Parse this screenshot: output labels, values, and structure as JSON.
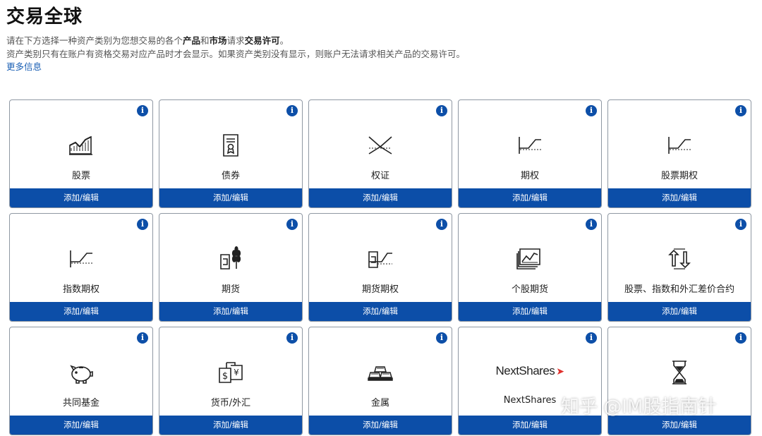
{
  "header": {
    "title": "交易全球",
    "desc_line1_pre": "请在下方选择一种资产类别为您想交易的各个",
    "desc_line1_b1": "产品",
    "desc_line1_and": "和",
    "desc_line1_b2": "市场",
    "desc_line1_mid": "请求",
    "desc_line1_b3": "交易许可",
    "desc_line1_end": "。",
    "desc_line2": "资产类别只有在账户有资格交易对应产品时才会显示。如果资产类别没有显示，则账户无法请求相关产品的交易许可。",
    "more_link": "更多信息"
  },
  "info_glyph": "i",
  "colors": {
    "accent": "#0c4ea8",
    "info": "#0d4fa8",
    "nextshares_red": "#e0312d"
  },
  "cards": [
    {
      "label": "股票",
      "icon": "stock-chart-icon",
      "action": "添加/编辑"
    },
    {
      "label": "债券",
      "icon": "bond-document-icon",
      "action": "添加/编辑"
    },
    {
      "label": "权证",
      "icon": "warrant-cross-icon",
      "action": "添加/编辑"
    },
    {
      "label": "期权",
      "icon": "option-payoff-icon",
      "action": "添加/编辑"
    },
    {
      "label": "股票期权",
      "icon": "stock-option-payoff-icon",
      "action": "添加/编辑"
    },
    {
      "label": "指数期权",
      "icon": "index-option-payoff-icon",
      "action": "添加/编辑"
    },
    {
      "label": "期货",
      "icon": "futures-wheat-icon",
      "action": "添加/编辑"
    },
    {
      "label": "期货期权",
      "icon": "futures-option-icon",
      "action": "添加/编辑"
    },
    {
      "label": "个股期货",
      "icon": "single-stock-futures-icon",
      "action": "添加/编辑"
    },
    {
      "label": "股票、指数和外汇差价合约",
      "icon": "cfd-exchange-icon",
      "action": "添加/编辑"
    },
    {
      "label": "共同基金",
      "icon": "piggy-bank-icon",
      "action": "添加/编辑"
    },
    {
      "label": "货币/外汇",
      "icon": "currency-exchange-icon",
      "action": "添加/编辑"
    },
    {
      "label": "金属",
      "icon": "gold-bars-icon",
      "action": "添加/编辑"
    },
    {
      "label": "NextShares",
      "icon": "nextshares-logo-icon",
      "logo_text": "NextShares",
      "action": "添加/编辑"
    },
    {
      "label": "",
      "icon": "hourglass-icon",
      "action": "添加/编辑"
    }
  ],
  "watermark": "知乎 @IM股指南针"
}
